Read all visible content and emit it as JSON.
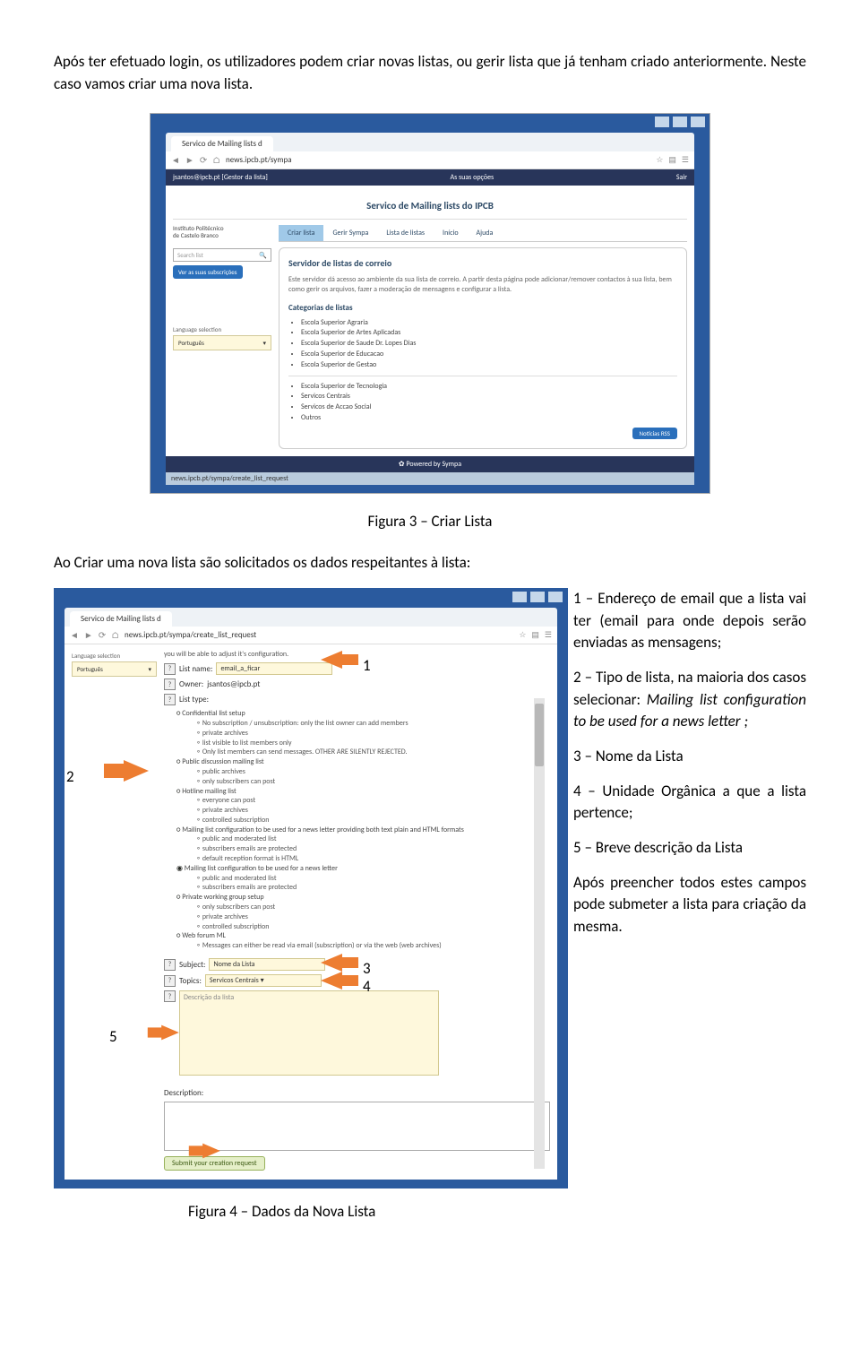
{
  "intro": "Após ter efetuado login, os utilizadores podem criar novas listas, ou gerir lista que já tenham criado anteriormente. Neste caso vamos criar uma nova lista.",
  "caption3": "Figura 3 – Criar Lista",
  "mid_para": "Ao Criar uma nova lista são solicitados os dados respeitantes à lista:",
  "caption4": "Figura 4 – Dados da Nova Lista",
  "legend": {
    "i1": "1 – Endereço de email que a lista vai ter (email para onde depois serão enviadas as mensagens;",
    "i2a": "2 – Tipo de lista, na maioria dos casos selecionar: ",
    "i2b": "Mailing list configuration to be used for a news letter ;",
    "i3": "3 – Nome da Lista",
    "i4": "4 – Unidade Orgânica a que a lista pertence;",
    "i5": "5 – Breve descrição da Lista",
    "after": "Após preencher todos estes campos pode submeter a lista para criação da mesma."
  },
  "shot1": {
    "tab_title": "Servico de Mailing lists d",
    "url": "news.ipcb.pt/sympa",
    "top_left": "jsantos@ipcb.pt  [Gestor da lista]",
    "top_center": "As suas opções",
    "top_right": "Sair",
    "service_title": "Servico de Mailing lists do IPCB",
    "institute_l1": "Instituto Politécnico",
    "institute_l2": "de Castelo Branco",
    "nav": {
      "t1": "Criar lista",
      "t2": "Gerir Sympa",
      "t3": "Lista de listas",
      "t4": "Início",
      "t5": "Ajuda"
    },
    "search_placeholder": "Search list",
    "blue_btn": "Ver as suas subscrições",
    "lang_label": "Language selection",
    "lang_value": "Português",
    "h4": "Servidor de listas de correio",
    "desc": "Este servidor dá acesso ao ambiente da sua lista de correio. A partir desta página pode adicionar/remover contactos à sua lista, bem como gerir os arquivos, fazer a moderação de mensagens e configurar a lista.",
    "h5": "Categorias de listas",
    "cats_a": [
      "Escola Superior Agraria",
      "Escola Superior de Artes Aplicadas",
      "Escola Superior de Saude Dr. Lopes Dias",
      "Escola Superior de Educacao",
      "Escola Superior de Gestao"
    ],
    "cats_b": [
      "Escola Superior de Tecnologia",
      "Servicos Centrais",
      "Servicos de Accao Social",
      "Outros"
    ],
    "rss": "Notícias RSS",
    "footer": "Powered by Sympa",
    "status": "news.ipcb.pt/sympa/create_list_request"
  },
  "shot2": {
    "tab_title": "Servico de Mailing lists d",
    "url": "news.ipcb.pt/sympa/create_list_request",
    "lang_label": "Language selection",
    "lang_value": "Português",
    "intro_line": "you will be able to adjust it's configuration.",
    "list_name_label": "List name:",
    "list_name_value": "email_a_ficar",
    "owner_label": "Owner:",
    "owner_value": "jsantos@ipcb.pt",
    "list_type_label": "List type:",
    "opts": {
      "r1": "Confidential list setup",
      "r1a": "No subscription / unsubscription: only the list owner can add members",
      "r1b": "private archives",
      "r1c": "list visible to list members only",
      "r1d": "Only list members can send messages. OTHER ARE SILENTLY REJECTED.",
      "r2": "Public discussion mailing list",
      "r2a": "public archives",
      "r2b": "only subscribers can post",
      "r3": "Hotline mailing list",
      "r3a": "everyone can post",
      "r3b": "private archives",
      "r3c": "controlled subscription",
      "r4": "Mailing list configuration to be used for a news letter providing both text plain and HTML formats",
      "r4a": "public and moderated list",
      "r4b": "subscribers emails are protected",
      "r4c": "default reception format is HTML",
      "r5": "Mailing list configuration to be used for a news letter",
      "r5a": "public and moderated list",
      "r5b": "subscribers emails are protected",
      "r6": "Private working group setup",
      "r6a": "only subscribers can post",
      "r6b": "private archives",
      "r6c": "controlled subscription",
      "r7": "Web forum ML",
      "r7a": "Messages can either be read via email (subscription) or via the web (web archives)"
    },
    "subject_label": "Subject:",
    "subject_value": "Nome da Lista",
    "topics_label": "Topics:",
    "topics_value": "Servicos Centrais",
    "desc_placeholder": "Descrição da lista",
    "desc_label": "Description:",
    "submit": "Submit your creation request"
  },
  "nums": {
    "n1": "1",
    "n2": "2",
    "n3": "3",
    "n4": "4",
    "n5": "5"
  }
}
